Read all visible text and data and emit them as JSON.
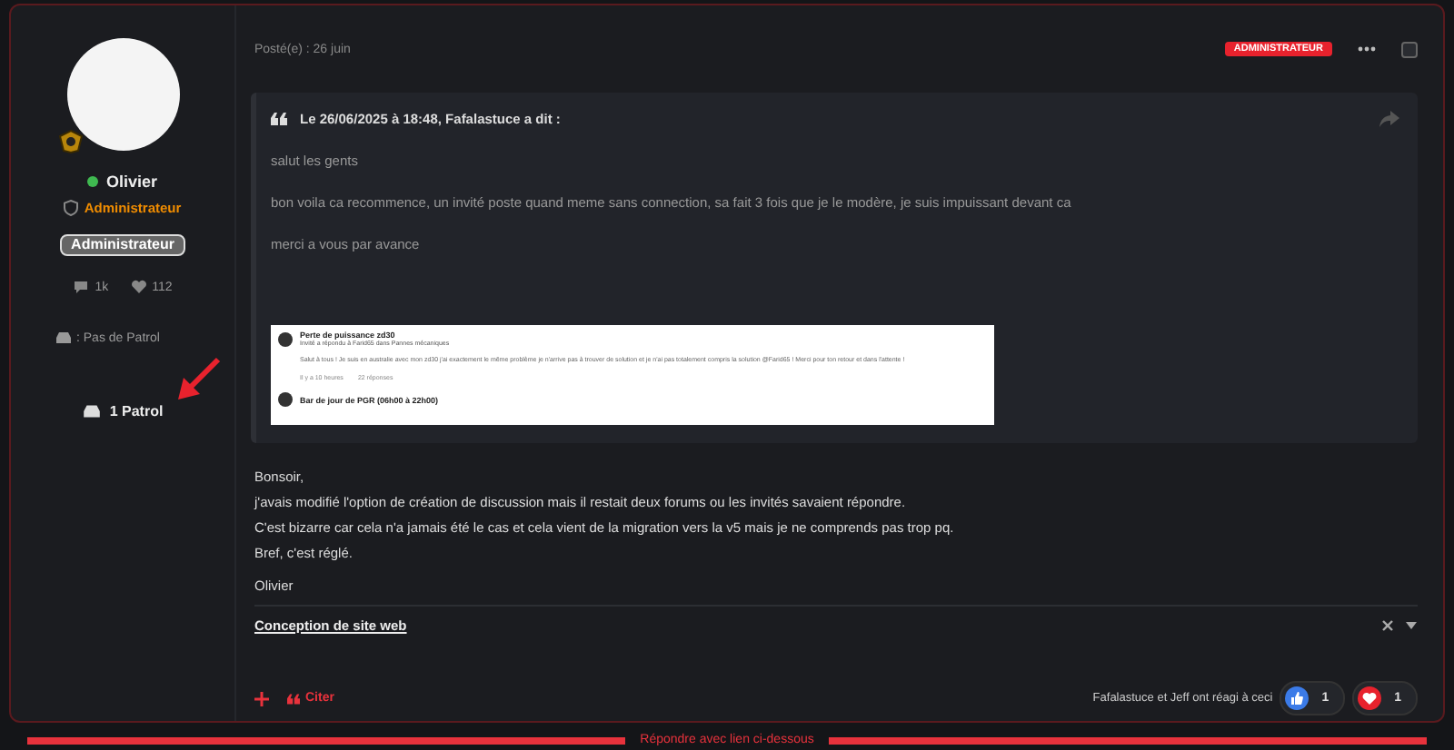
{
  "author": {
    "name": "Olivier",
    "online": true,
    "role": "Administrateur",
    "badge": "Administrateur",
    "stats": [
      {
        "kind": "comments",
        "value": "1k"
      },
      {
        "kind": "likes",
        "value": "112"
      }
    ],
    "patrol_label": ": Pas de Patrol",
    "patrol_count": "1 Patrol"
  },
  "post": {
    "selected": false,
    "posted": "Posté(e) : 26 juin",
    "role_tag": "ADMINISTRATEUR",
    "quote": {
      "header": "Le 26/06/2025 à 18:48, Fafalastuce a dit :",
      "lines": [
        "salut les gents",
        "bon voila ca recommence, un invité poste quand meme sans connection, sa fait 3 fois que je le modère, je suis impuissant devant ca",
        "merci a vous par avance"
      ],
      "embedded_screenshot": {
        "title": "Perte de puissance zd30",
        "meta": "Invité a répondu à Farid65 dans Pannes mécaniques",
        "excerpt": "Salut à tous ! Je suis en australie avec mon zd30 j'ai exactement le même problème je n'arrive pas à trouver de solution et je n'ai pas totalement compris la solution @Farid65 ! Merci pour ton retour et dans l'attente !",
        "time": "Il y a 10 heures",
        "replies": "22 réponses",
        "next_title": "Bar de jour de PGR (06h00 à 22h00)"
      }
    },
    "body": [
      "Bonsoir,",
      "j'avais modifié l'option de création de discussion mais il restait deux forums ou les invités savaient répondre.",
      "C'est bizarre car cela n'a jamais été le cas et cela vient de la migration vers la v5 mais je ne comprends pas trop pq.",
      "Bref, c'est réglé."
    ],
    "signature_name": "Olivier",
    "signature_link": "Conception de site web",
    "footer": {
      "quote_button": "Citer",
      "reactions_text": "Fafalastuce et Jeff ont réagi à ceci",
      "reactions": [
        {
          "kind": "like",
          "count": "1"
        },
        {
          "kind": "love",
          "count": "1"
        }
      ]
    }
  },
  "bottom_banner": "Répondre avec lien ci-dessous"
}
